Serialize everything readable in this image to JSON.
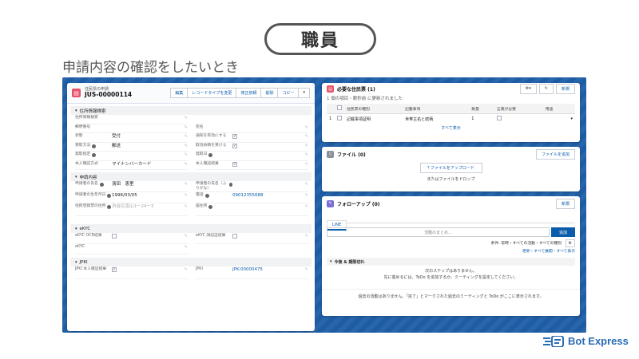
{
  "slide": {
    "title": "職員",
    "subtitle": "申請内容の確認をしたいとき"
  },
  "record": {
    "object_label": "住民票の申請",
    "name": "JUS-00000114",
    "buttons": [
      "編集",
      "レコードタイプを変更",
      "修正依頼",
      "削除",
      "コピー"
    ],
    "caret": "▾"
  },
  "sections": {
    "s1": "住所情報検索",
    "s2": "申請内容",
    "s3": "eKYC",
    "s4": "JPKI"
  },
  "fields": {
    "jusho_kensaku": {
      "label": "住所情報検索"
    },
    "yubin": {
      "label": "郵便番号"
    },
    "jotai": {
      "label": "状態",
      "value": "受付"
    },
    "uketori": {
      "label": "受取方法",
      "value": "郵送"
    },
    "hasso": {
      "label": "発取指定"
    },
    "honnin": {
      "label": "本人確認方式",
      "value": "マイナンバーカード"
    },
    "atena": {
      "label": "宛名"
    },
    "tsuuchi": {
      "label": "通知を有効にする"
    },
    "torikeshi": {
      "label": "取消依頼を受ける"
    },
    "hassobi": {
      "label": "発取日"
    },
    "honnin_kekka": {
      "label": "本人確認結果"
    },
    "shimei": {
      "label": "申請者の氏名",
      "value": "濱田　恵里"
    },
    "seinen": {
      "label": "申請者の生年月日",
      "value": "1996/03/05"
    },
    "jusho": {
      "label": "住民登録票の住所",
      "value": "渋谷区南山1ー24ー3"
    },
    "furigana": {
      "label": "申請者の氏名（ふりがな）"
    },
    "denwa": {
      "label": "電話",
      "value": "09012355688"
    },
    "kyosho": {
      "label": "居住所"
    },
    "ocr": {
      "label": "eKYC OCR結果"
    },
    "ekyc": {
      "label": "eKYC"
    },
    "face": {
      "label": "eKYC 顔認証結果"
    },
    "jpki_result": {
      "label": "JPKI 本人確認結果"
    },
    "jpki": {
      "label": "JPKI",
      "value": "JPK-00000475"
    }
  },
  "docs_card": {
    "title": "必要な住民票 (1)",
    "sub": "1 個の項目・数秒前 に更新されました",
    "new_btn": "新規",
    "columns": [
      "住民票の種別",
      "記載事項",
      "数量",
      "言葉が必要",
      "用途"
    ],
    "row": {
      "num": "1",
      "type": "記載事項証明",
      "items": "世帯主名と続柄",
      "qty": "1"
    },
    "view_all": "すべて表示"
  },
  "files_card": {
    "title": "ファイル (0)",
    "add_btn": "ファイルを追加",
    "upload_btn": "ファイルをアップロード",
    "drop_text": "またはファイルをドロップ"
  },
  "follow_card": {
    "title": "フォローアップ (0)",
    "new_btn": "新規",
    "tab": "LINE",
    "placeholder": "活動のまとめ...",
    "post_btn": "追加",
    "filter": "条件: 常時・すべての活動・すべての種別",
    "links": "更新・すべて展開・すべて表示",
    "upcoming": "今後 & 期限切れ",
    "no_steps_1": "次のステップはありません。",
    "no_steps_2": "先に進めるには、ToDo を追加するか、ミーティングを設定してください。",
    "past": "過去の活動はありません。「完了」とマークされた過去のミーティングと ToDo がここに表示されます。"
  },
  "brand": {
    "name": "Bot Express"
  },
  "colors": {
    "brand": "#2a6db5",
    "header_bg": "#1f5fa8",
    "record_icon": "#e8546b"
  }
}
